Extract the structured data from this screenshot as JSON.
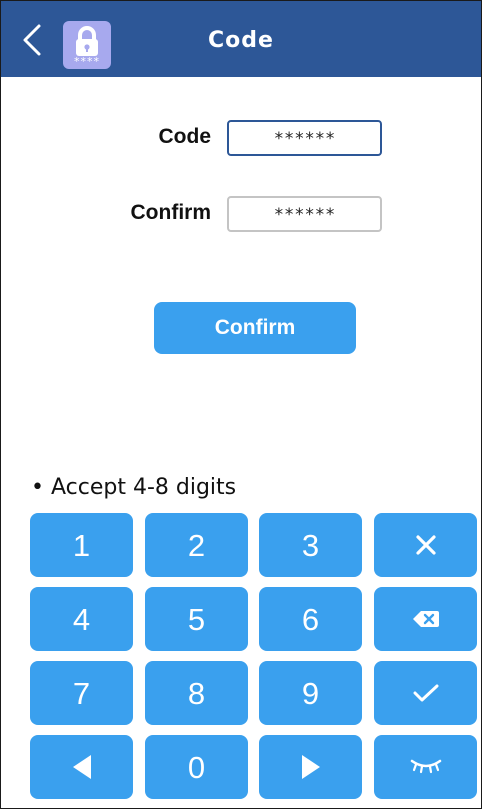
{
  "header": {
    "title": "Code",
    "back_icon": "chevron-left-icon",
    "badge_icon": "lock-icon",
    "badge_stars": "****",
    "background_color": "#2d5797",
    "badge_color": "#a7a9ee"
  },
  "form": {
    "code_label": "Code",
    "code_value": "******",
    "confirm_label": "Confirm",
    "confirm_value": "******"
  },
  "confirm_button": {
    "label": "Confirm",
    "color": "#3aa0ee"
  },
  "hint": "• Accept 4-8 digits",
  "keypad": {
    "keys": [
      {
        "label": "1"
      },
      {
        "label": "2"
      },
      {
        "label": "3"
      },
      {
        "label": "",
        "icon": "close-icon"
      },
      {
        "label": "4"
      },
      {
        "label": "5"
      },
      {
        "label": "6"
      },
      {
        "label": "",
        "icon": "backspace-icon"
      },
      {
        "label": "7"
      },
      {
        "label": "8"
      },
      {
        "label": "9"
      },
      {
        "label": "",
        "icon": "check-icon"
      },
      {
        "label": "",
        "icon": "left-arrow-icon"
      },
      {
        "label": "0"
      },
      {
        "label": "",
        "icon": "right-arrow-icon"
      },
      {
        "label": "",
        "icon": "eye-closed-icon"
      }
    ],
    "key_color": "#3aa0ee"
  }
}
